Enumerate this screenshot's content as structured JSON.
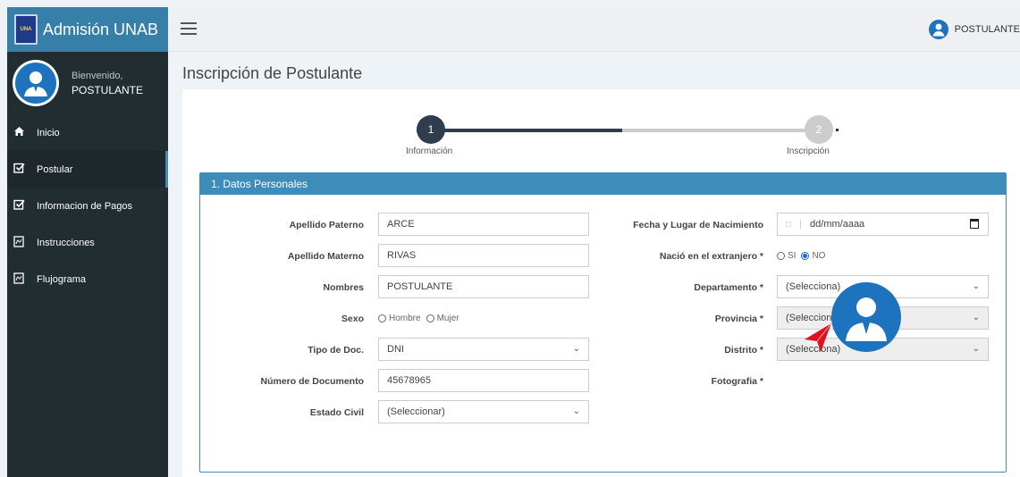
{
  "app": {
    "title": "Admisión UNAB",
    "logo_text": "UNA"
  },
  "sidebar": {
    "welcome": "Bienvenido,",
    "username": "POSTULANTE",
    "items": [
      {
        "label": "Inicio",
        "icon": "home-icon"
      },
      {
        "label": "Postular",
        "icon": "checkbox-icon"
      },
      {
        "label": "Informacion de Pagos",
        "icon": "checkbox-icon"
      },
      {
        "label": "Instrucciones",
        "icon": "document-icon"
      },
      {
        "label": "Flujograma",
        "icon": "document-icon"
      }
    ]
  },
  "header": {
    "user_label": "POSTULANTE"
  },
  "page": {
    "title": "Inscripción de Postulante"
  },
  "stepper": {
    "steps": [
      {
        "number": "1",
        "label": "Información"
      },
      {
        "number": "2",
        "label": "Inscripción"
      }
    ],
    "colors": {
      "active": "#2f3e4e",
      "inactive": "#cccccc"
    }
  },
  "panel": {
    "title": "1. Datos Personales"
  },
  "form": {
    "apellido_paterno": {
      "label": "Apellido Paterno",
      "value": "ARCE"
    },
    "apellido_materno": {
      "label": "Apellido Materno",
      "value": "RIVAS"
    },
    "nombres": {
      "label": "Nombres",
      "value": "POSTULANTE"
    },
    "sexo": {
      "label": "Sexo",
      "options": [
        "Hombre",
        "Mujer"
      ]
    },
    "tipo_doc": {
      "label": "Tipo de Doc.",
      "value": "DNI"
    },
    "numero_documento": {
      "label": "Número de Documento",
      "value": "45678965"
    },
    "estado_civil": {
      "label": "Estado Civil",
      "value": "(Seleccionar)"
    },
    "fecha_nacimiento": {
      "label": "Fecha y Lugar de Nacimiento",
      "placeholder": "dd/mm/aaaa"
    },
    "extranjero": {
      "label": "Nació en el extranjero *",
      "options": [
        "SI",
        "NO"
      ],
      "selected": "NO"
    },
    "departamento": {
      "label": "Departamento *",
      "value": "(Selecciona)"
    },
    "provincia": {
      "label": "Provincia *",
      "value": "(Selecciona)"
    },
    "distrito": {
      "label": "Distrito *",
      "value": "(Selecciona)"
    },
    "fotografia": {
      "label": "Fotografia *"
    }
  },
  "colors": {
    "sidebar_bg": "#222d32",
    "brand_bg": "#367fa9",
    "panel_accent": "#3c8dbc",
    "pointer": "#e0101f"
  }
}
